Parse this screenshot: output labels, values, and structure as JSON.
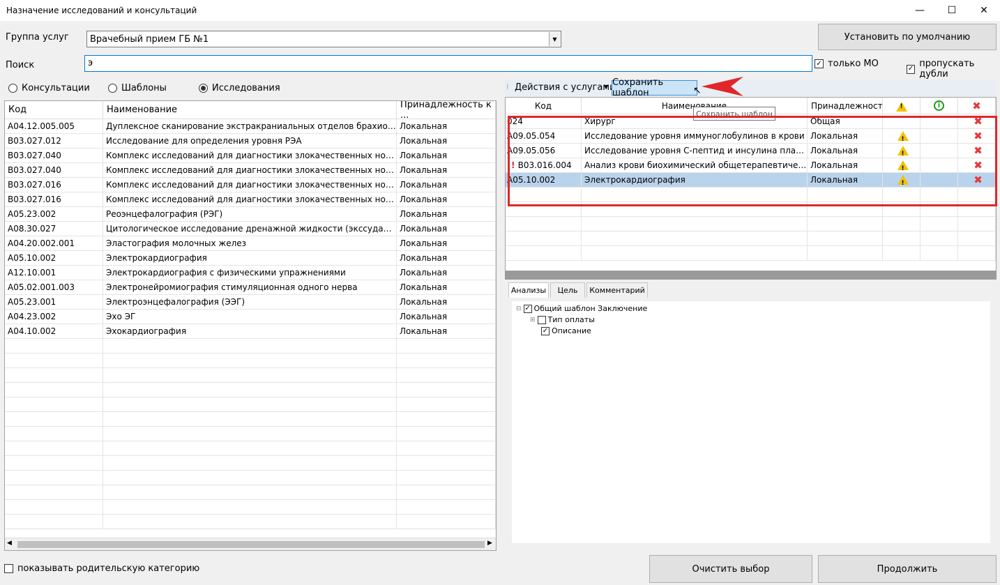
{
  "window": {
    "title": "Назначение исследований и консультаций",
    "min": "—",
    "max": "☐",
    "close": "✕"
  },
  "group": {
    "label": "Группа услуг",
    "value": "Врачебный прием ГБ №1"
  },
  "search": {
    "label": "Поиск",
    "value": "э"
  },
  "buttons": {
    "default": "Установить по умолчанию",
    "clear": "Очистить выбор",
    "continue": "Продолжить"
  },
  "options": {
    "only_mo": "только МО",
    "skip_dupes": "пропускать дубли",
    "show_parent": "показывать родительскую категорию"
  },
  "radios": {
    "consult": "Консультации",
    "templates": "Шаблоны",
    "research": "Исследования"
  },
  "left_grid": {
    "headers": [
      "Код",
      "Наименование",
      "Принадлежность к ..."
    ],
    "rows": [
      [
        "A04.12.005.005",
        "Дуплексное сканирование экстракраниальных отделов брахиоцеф...",
        "Локальная"
      ],
      [
        "B03.027.012",
        "Исследование для определения уровня РЭА",
        "Локальная"
      ],
      [
        "B03.027.040",
        "Комплекс исследований для диагностики злокачественных новооб...",
        "Локальная"
      ],
      [
        "B03.027.040",
        "Комплекс исследований для диагностики злокачественных новооб...",
        "Локальная"
      ],
      [
        "B03.027.016",
        "Комплекс исследований для диагностики злокачественных новооб...",
        "Локальная"
      ],
      [
        "B03.027.016",
        "Комплекс исследований для диагностики злокачественных новооб...",
        "Локальная"
      ],
      [
        "A05.23.002",
        "Реоэнцефалография (РЭГ)",
        "Локальная"
      ],
      [
        "A08.30.027",
        "Цитологическое исследование дренажной жидкости (экссудаты, тр...",
        "Локальная"
      ],
      [
        "A04.20.002.001",
        "Эластография молочных желез",
        "Локальная"
      ],
      [
        "A05.10.002",
        "Электрокардиография",
        "Локальная"
      ],
      [
        "A12.10.001",
        "Электрокардиография с физическими упражнениями",
        "Локальная"
      ],
      [
        "A05.02.001.003",
        "Электронейромиография стимуляционная одного нерва",
        "Локальная"
      ],
      [
        "A05.23.001",
        "Электроэнцефалография (ЭЭГ)",
        "Локальная"
      ],
      [
        "A04.23.002",
        "Эхо ЭГ",
        "Локальная"
      ],
      [
        "A04.10.002",
        "Эхокардиография",
        "Локальная"
      ]
    ]
  },
  "toolbar": {
    "actions": "Действия с услугами",
    "save_template": "Сохранить шаблон",
    "tooltip": "Сохранить шаблон"
  },
  "right_grid": {
    "headers": [
      "Код",
      "Наименование",
      "Принадлежность"
    ],
    "rows": [
      {
        "code": "024",
        "name": "Хирург",
        "owner": "Общая",
        "warn": false,
        "mark": false
      },
      {
        "code": "A09.05.054",
        "name": "Исследование уровня иммуноглобулинов в крови",
        "owner": "Локальная",
        "warn": true,
        "mark": false
      },
      {
        "code": "A09.05.056",
        "name": "Исследование уровня С-пептид и инсулина плазм...",
        "owner": "Локальная",
        "warn": true,
        "mark": false
      },
      {
        "code": "B03.016.004",
        "name": "Анализ крови биохимический общетерапевтическ...",
        "owner": "Локальная",
        "warn": true,
        "mark": true
      },
      {
        "code": "A05.10.002",
        "name": "Электрокардиография",
        "owner": "Локальная",
        "warn": true,
        "mark": false
      }
    ]
  },
  "tabs": [
    "Анализы",
    "Цель",
    "Комментарий"
  ],
  "tree": {
    "root": "Общий шаблон Заключение",
    "child1": "Тип оплаты",
    "child2": "Описание"
  },
  "colors": {
    "highlight_red": "#e0262a",
    "selected_row": "#bad3ec"
  }
}
